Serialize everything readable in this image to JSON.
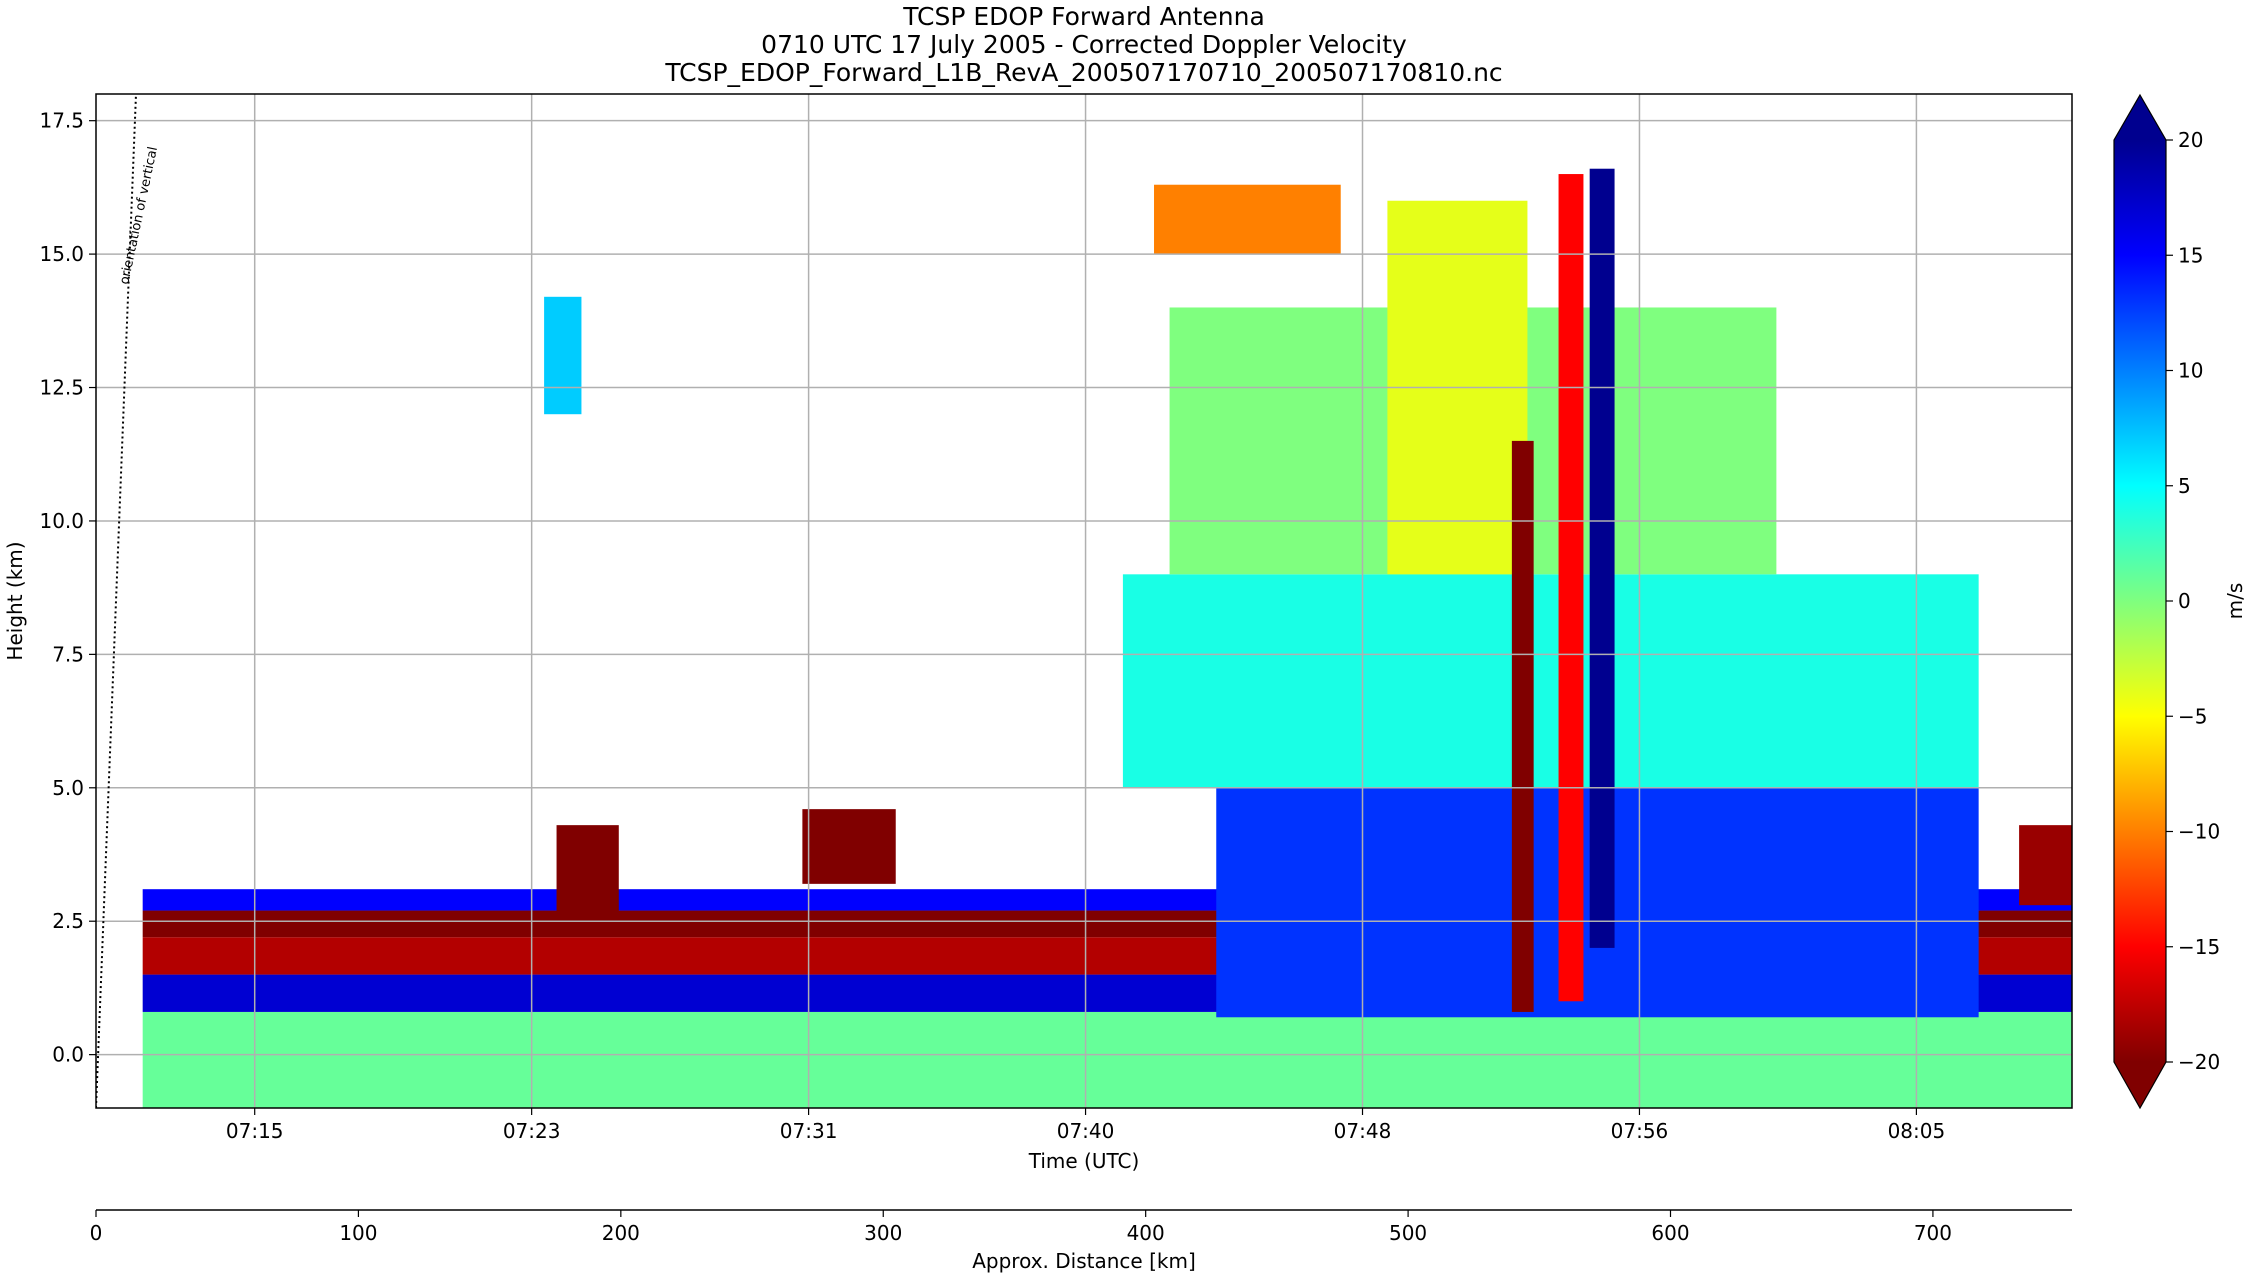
{
  "chart_data": {
    "type": "heatmap",
    "title": [
      "TCSP EDOP Forward Antenna",
      "0710 UTC 17 July 2005 - Corrected Doppler Velocity",
      "TCSP_EDOP_Forward_L1B_RevA_200507170710_200507170810.nc"
    ],
    "xlabel": "Time (UTC)",
    "ylabel": "Height (km)",
    "x_ticks": [
      {
        "label": "07:15",
        "t": 5.1
      },
      {
        "label": "07:23",
        "t": 14.0
      },
      {
        "label": "07:31",
        "t": 22.9
      },
      {
        "label": "07:40",
        "t": 31.8
      },
      {
        "label": "07:48",
        "t": 40.7
      },
      {
        "label": "07:56",
        "t": 49.6
      },
      {
        "label": "08:05",
        "t": 58.5
      }
    ],
    "xlim_minutes_after_0710": [
      0,
      63.5
    ],
    "ylim": [
      -1.0,
      18.0
    ],
    "y_ticks": [
      "0.0",
      "2.5",
      "5.0",
      "7.5",
      "10.0",
      "12.5",
      "15.0",
      "17.5"
    ],
    "grid": true,
    "colorbar": {
      "label": "m/s",
      "range": [
        -20,
        20
      ],
      "ticks": [
        "−20",
        "−15",
        "−10",
        "−5",
        "0",
        "5",
        "10",
        "15",
        "20"
      ],
      "colormap": "jet_r",
      "extend": "both"
    },
    "secondary_x_axis": {
      "label": "Approx. Distance [km]",
      "ticks": [
        "0",
        "100",
        "200",
        "300",
        "400",
        "500",
        "600",
        "700"
      ],
      "range_km": [
        0,
        753
      ]
    },
    "annotation": "orientation of vertical",
    "fields": [
      {
        "t0": 1.5,
        "t1": 63.5,
        "z0": -1.0,
        "z1": 0.8,
        "v": 1
      },
      {
        "t0": 1.5,
        "t1": 63.5,
        "z0": 0.8,
        "z1": 1.5,
        "v": 17
      },
      {
        "t0": 1.5,
        "t1": 63.5,
        "z0": 1.5,
        "z1": 2.2,
        "v": -18
      },
      {
        "t0": 1.5,
        "t1": 63.5,
        "z0": 2.2,
        "z1": 2.7,
        "v": -20
      },
      {
        "t0": 1.5,
        "t1": 63.5,
        "z0": 2.7,
        "z1": 3.1,
        "v": 15
      },
      {
        "t0": 14.8,
        "t1": 16.8,
        "z0": 2.5,
        "z1": 4.3,
        "v": -20
      },
      {
        "t0": 22.7,
        "t1": 25.7,
        "z0": 3.2,
        "z1": 4.6,
        "v": -20
      },
      {
        "t0": 36.0,
        "t1": 60.5,
        "z0": 0.7,
        "z1": 5.0,
        "v": 13
      },
      {
        "t0": 33.0,
        "t1": 60.5,
        "z0": 5.0,
        "z1": 9.0,
        "v": 4
      },
      {
        "t0": 34.5,
        "t1": 54.0,
        "z0": 9.0,
        "z1": 14.0,
        "v": 0
      },
      {
        "t0": 41.5,
        "t1": 46.0,
        "z0": 9.0,
        "z1": 16.0,
        "v": -4
      },
      {
        "t0": 45.5,
        "t1": 46.2,
        "z0": 0.8,
        "z1": 11.5,
        "v": -20
      },
      {
        "t0": 47.0,
        "t1": 47.8,
        "z0": 1.0,
        "z1": 16.5,
        "v": -15
      },
      {
        "t0": 48.0,
        "t1": 48.8,
        "z0": 2.0,
        "z1": 16.6,
        "v": 20
      },
      {
        "t0": 34.0,
        "t1": 40.0,
        "z0": 15.0,
        "z1": 16.3,
        "v": -10
      },
      {
        "t0": 14.4,
        "t1": 15.6,
        "z0": 12.0,
        "z1": 14.2,
        "v": 7
      },
      {
        "t0": 61.8,
        "t1": 63.5,
        "z0": 2.8,
        "z1": 4.3,
        "v": -19
      }
    ]
  }
}
